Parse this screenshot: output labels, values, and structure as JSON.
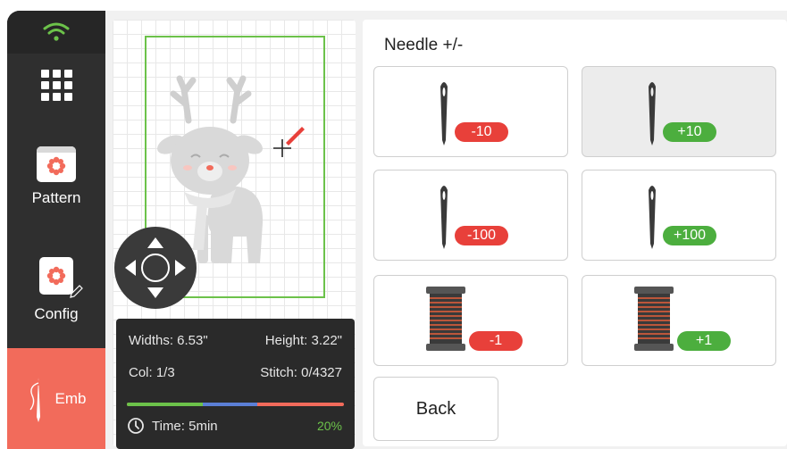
{
  "sidebar": {
    "items": [
      {
        "name": "wifi",
        "icon": "wifi-icon"
      },
      {
        "name": "apps",
        "icon": "grid-icon"
      },
      {
        "name": "pattern",
        "label": "Pattern",
        "icon": "flower-icon"
      },
      {
        "name": "config",
        "label": "Config",
        "icon": "flower-edit-icon"
      },
      {
        "name": "emb",
        "label": "Emb",
        "icon": "needle-thread-icon",
        "active": true
      }
    ]
  },
  "canvas": {
    "design_icon": "reindeer-embroidery-icon",
    "cursor_icon": "crosshair-pencil-icon",
    "dpad_icon": "move-dpad-icon"
  },
  "info": {
    "widths_label": "Widths: 6.53\"",
    "height_label": "Height: 3.22\"",
    "col_label": "Col: 1/3",
    "stitch_label": "Stitch: 0/4327",
    "time_label": "Time: 5min",
    "percent": "20%",
    "progress_colors": [
      "#6cc24a",
      "#5b7fd6",
      "#f26b5b"
    ],
    "progress_fractions": [
      0.35,
      0.25,
      0.4
    ]
  },
  "panel": {
    "title": "Needle +/-",
    "buttons": [
      {
        "badge": "-10",
        "kind": "needle",
        "color": "red"
      },
      {
        "badge": "+10",
        "kind": "needle",
        "color": "green",
        "active": true
      },
      {
        "badge": "-100",
        "kind": "needle",
        "color": "red"
      },
      {
        "badge": "+100",
        "kind": "needle",
        "color": "green"
      },
      {
        "badge": "-1",
        "kind": "spool",
        "color": "red"
      },
      {
        "badge": "+1",
        "kind": "spool",
        "color": "green"
      }
    ],
    "back_label": "Back"
  },
  "colors": {
    "accent_red": "#e8403a",
    "accent_green": "#4cae3e",
    "emb_active": "#f26b5b",
    "sidebar": "#2f2f2f",
    "hoop": "#6cc24a"
  }
}
